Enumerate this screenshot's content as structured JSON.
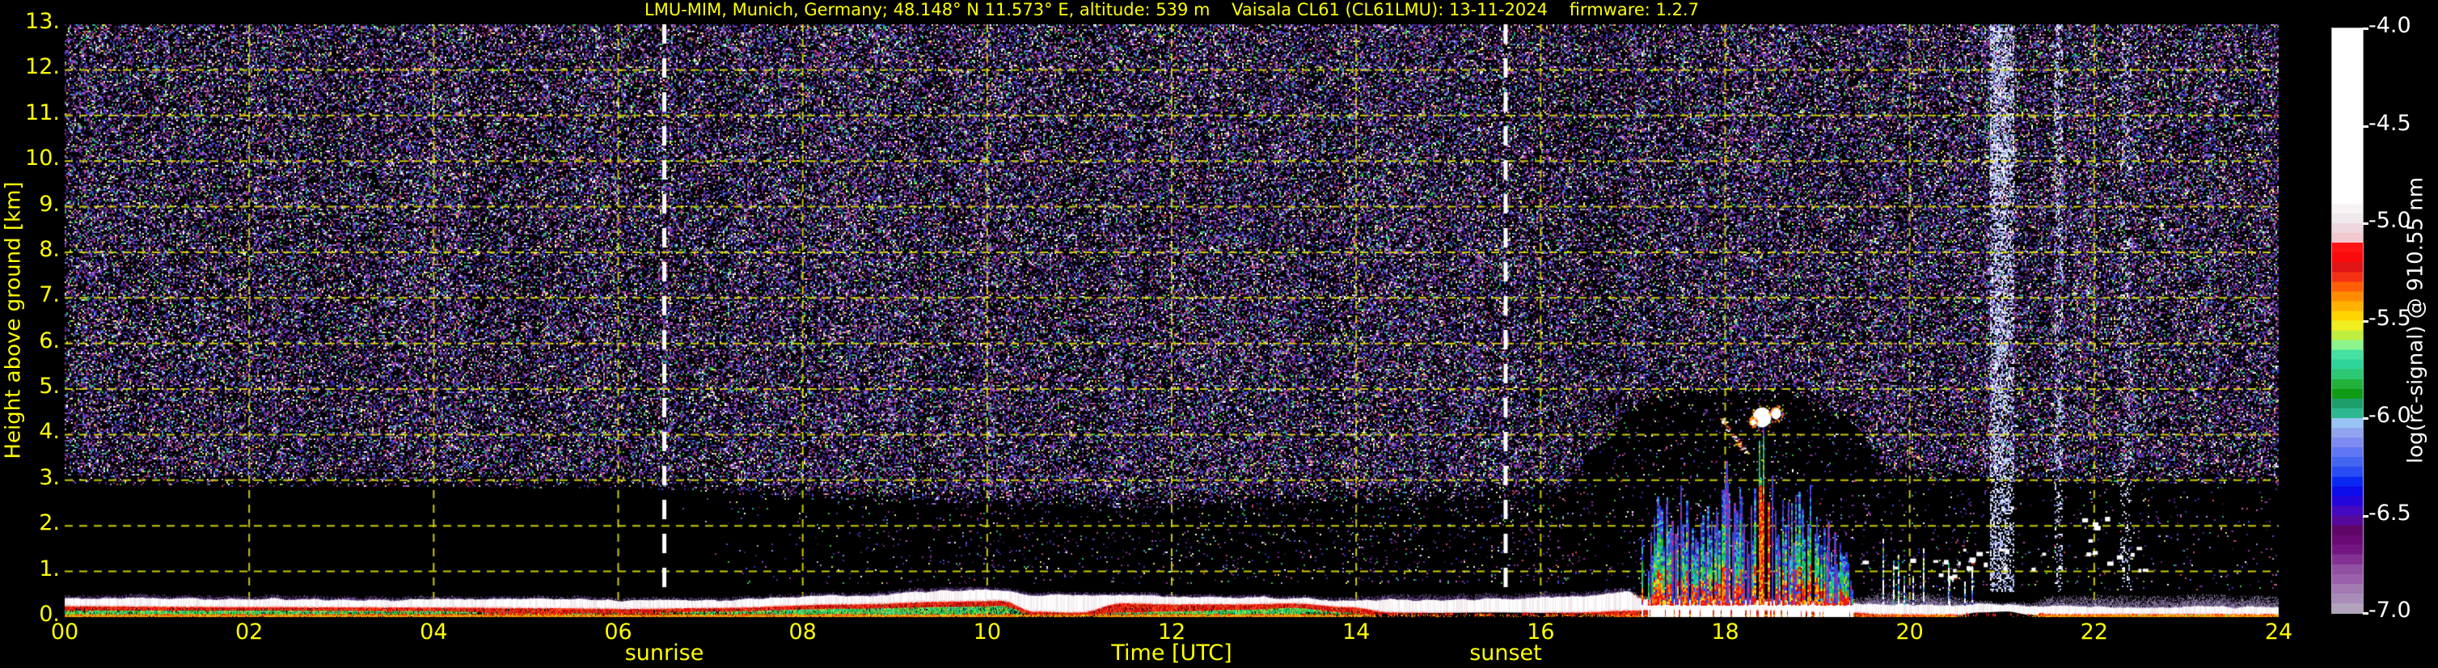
{
  "title": "LMU-MIM, Munich, Germany; 48.148° N 11.573° E, altitude: 539 m    Vaisala CL61 (CL61LMU): 13-11-2024    firmware: 1.2.7",
  "axes": {
    "x": {
      "label": "Time [UTC]",
      "ticks": [
        0,
        2,
        4,
        6,
        8,
        10,
        12,
        14,
        16,
        18,
        20,
        22,
        24
      ],
      "tick_labels": [
        "00",
        "02",
        "04",
        "06",
        "08",
        "10",
        "12",
        "14",
        "16",
        "18",
        "20",
        "22",
        "24"
      ]
    },
    "y": {
      "label": "Height above ground [km]",
      "ticks": [
        0,
        1,
        2,
        3,
        4,
        5,
        6,
        7,
        8,
        9,
        10,
        11,
        12,
        13
      ],
      "tick_labels": [
        "0.",
        "1.",
        "2.",
        "3.",
        "4.",
        "5.",
        "6.",
        "7.",
        "8.",
        "9.",
        "10.",
        "11.",
        "12.",
        "13."
      ]
    }
  },
  "annotations": {
    "sunrise": {
      "label": "sunrise",
      "time": 6.5
    },
    "sunset": {
      "label": "sunset",
      "time": 15.62
    }
  },
  "colorbar": {
    "label": "log(rc-signal) @ 910.55 nm",
    "ticks": [
      -4.0,
      -4.5,
      -5.0,
      -5.5,
      -6.0,
      -6.5,
      -7.0
    ],
    "tick_labels": [
      "-4.0",
      "-4.5",
      "-5.0",
      "-5.5",
      "-6.0",
      "-6.5",
      "-7.0"
    ],
    "blocks_bottom_to_top": [
      "#b2a4bd",
      "#a98cb7",
      "#a379b2",
      "#9b60aa",
      "#9150a2",
      "#843194",
      "#741682",
      "#6a0a74",
      "#600668",
      "#55089c",
      "#4408c0",
      "#2406da",
      "#0d0cea",
      "#0a28f4",
      "#2a4cf4",
      "#4464f2",
      "#6076f4",
      "#7e8cf2",
      "#91a4f0",
      "#98c4f4",
      "#2cb890",
      "#1d9e6a",
      "#0f9c14",
      "#22b23c",
      "#2cc874",
      "#2ed598",
      "#46e0a2",
      "#8cf58c",
      "#c0ee40",
      "#f0ee20",
      "#ffd400",
      "#ffb000",
      "#ff8c00",
      "#ff5e06",
      "#f43014",
      "#e01414",
      "#fa0a0a",
      "#ff1414",
      "#f2c8ce",
      "#eed7de",
      "#efe8ec",
      "#f7f3f5",
      "#ffffff",
      "#ffffff",
      "#ffffff",
      "#ffffff",
      "#ffffff",
      "#ffffff",
      "#ffffff",
      "#ffffff",
      "#ffffff",
      "#ffffff",
      "#ffffff",
      "#ffffff",
      "#ffffff",
      "#ffffff",
      "#ffffff",
      "#ffffff",
      "#ffffff",
      "#ffffff"
    ]
  },
  "chart_data": {
    "type": "heatmap",
    "title": "LMU-MIM, Munich, Germany; 48.148° N 11.573° E, altitude: 539 m    Vaisala CL61 (CL61LMU): 13-11-2024    firmware: 1.2.7",
    "xlabel": "Time [UTC]",
    "ylabel": "Height above ground [km]",
    "xlim": [
      0,
      24
    ],
    "ylim": [
      0,
      13
    ],
    "clim": [
      -7.0,
      -4.0
    ],
    "grid": {
      "on": true,
      "color": "#e2e200",
      "style": "dashed",
      "x_every_h": 2,
      "y_every_km": 1
    },
    "sun_lines": {
      "color": "#ffffff",
      "sunrise_t": 6.5,
      "sunset_t": 15.62
    },
    "noise": {
      "seed": 1337,
      "floor_km": [
        [
          0,
          2.9
        ],
        [
          6,
          2.85
        ],
        [
          8,
          2.6
        ],
        [
          10,
          2.45
        ],
        [
          12,
          2.4
        ],
        [
          13.5,
          2.5
        ],
        [
          15,
          2.6
        ],
        [
          16.2,
          2.7
        ],
        [
          16.6,
          3.6
        ],
        [
          17.0,
          4.6
        ],
        [
          17.6,
          4.9
        ],
        [
          18.6,
          4.9
        ],
        [
          19.3,
          4.3
        ],
        [
          19.8,
          3.1
        ],
        [
          20.5,
          2.95
        ],
        [
          24,
          2.95
        ]
      ],
      "ramp_km": 0.55,
      "base_density": 0.46,
      "palette": [
        "#2b1240",
        "#2b1240",
        "#46206e",
        "#46206e",
        "#5e2d92",
        "#5e2d92",
        "#7a3fae",
        "#3230c8",
        "#3230c8",
        "#4a55e6",
        "#8091f0",
        "#9a35a0",
        "#9a35a0",
        "#c060c0",
        "#b8a8dc",
        "#28b89c",
        "#38c848",
        "#e8e860",
        "#ffffff",
        "#d84860"
      ],
      "day_sparse": {
        "t0": 6.6,
        "t1": 16.6,
        "h0": 0.75,
        "density": 0.045
      },
      "event_sparse": {
        "t0": 16.7,
        "t1": 20.6,
        "h1": 5.2,
        "density": 0.055
      },
      "night_sparse": {
        "t0": 19.5,
        "t1": 24,
        "h0": 0.6,
        "h1": 3.0,
        "density": 0.028
      }
    },
    "pale_columns": [
      {
        "t0": 20.87,
        "t1": 21.03,
        "density": 0.5,
        "top_boost": 0.62
      },
      {
        "t0": 21.05,
        "t1": 21.13,
        "density": 0.4,
        "top_boost": 0.5
      },
      {
        "t0": 21.57,
        "t1": 21.65,
        "density": 0.28,
        "top_boost": 0.34
      },
      {
        "t0": 22.28,
        "t1": 22.4,
        "density": 0.16,
        "top_boost": 0.18
      }
    ],
    "pale_palette": [
      "#c8d0f0",
      "#a8b4ec",
      "#e4e8fa",
      "#8898e0",
      "#ffffff",
      "#b0c4f4"
    ],
    "surface": {
      "keyframes_t_g_r_w_cap_bb_oL_gS": [
        [
          0.0,
          0.14,
          0.24,
          0.42,
          0.5,
          0,
          1,
          0.9
        ],
        [
          2.0,
          0.14,
          0.22,
          0.4,
          0.48,
          0,
          1,
          1
        ],
        [
          4.0,
          0.13,
          0.21,
          0.38,
          0.45,
          0,
          1,
          0.8
        ],
        [
          4.9,
          0.08,
          0.2,
          0.41,
          0.48,
          0,
          1,
          0.35
        ],
        [
          6.2,
          0.08,
          0.18,
          0.36,
          0.43,
          0,
          1,
          0.4
        ],
        [
          7.0,
          0.12,
          0.2,
          0.38,
          0.45,
          0,
          1,
          0.8
        ],
        [
          8.5,
          0.18,
          0.28,
          0.48,
          0.55,
          0,
          1,
          1
        ],
        [
          9.6,
          0.22,
          0.34,
          0.58,
          0.66,
          0,
          1,
          1
        ],
        [
          10.15,
          0.24,
          0.36,
          0.6,
          0.66,
          0,
          1,
          0.9
        ],
        [
          10.5,
          0.06,
          0.12,
          0.5,
          0.56,
          0,
          0.8,
          0.15
        ],
        [
          11.0,
          0.05,
          0.1,
          0.48,
          0.54,
          0,
          0.8,
          0.15
        ],
        [
          11.45,
          0.1,
          0.3,
          0.5,
          0.56,
          0,
          1,
          0.7
        ],
        [
          12.0,
          0.12,
          0.28,
          0.46,
          0.52,
          0,
          1,
          1
        ],
        [
          12.8,
          0.16,
          0.28,
          0.44,
          0.5,
          0,
          1,
          1
        ],
        [
          13.3,
          0.2,
          0.3,
          0.42,
          0.48,
          0,
          1,
          1
        ],
        [
          13.9,
          0.1,
          0.22,
          0.36,
          0.44,
          0,
          0.9,
          0.5
        ],
        [
          14.4,
          0,
          0.1,
          0.38,
          0.5,
          0.08,
          0.25,
          0
        ],
        [
          15.5,
          0,
          0.08,
          0.4,
          0.52,
          0.1,
          0.2,
          0
        ],
        [
          16.4,
          0,
          0.1,
          0.46,
          0.56,
          0.08,
          0.3,
          0
        ],
        [
          16.95,
          0,
          0.14,
          0.55,
          0.62,
          0,
          0.5,
          0
        ],
        [
          17.15,
          0,
          0.15,
          0.38,
          0.46,
          0,
          0.7,
          0
        ],
        [
          18.2,
          0,
          0.15,
          0.36,
          0.44,
          0,
          0.7,
          0
        ],
        [
          19.35,
          0,
          0.1,
          0.32,
          0.42,
          0,
          0.5,
          0
        ],
        [
          19.7,
          0,
          0.06,
          0.28,
          0.55,
          0,
          0.5,
          0
        ],
        [
          20.4,
          0,
          0.05,
          0.27,
          0.5,
          0,
          0.6,
          0
        ],
        [
          20.75,
          0,
          0,
          0.3,
          0.36,
          0.1,
          0,
          0
        ],
        [
          21.05,
          0,
          0,
          0.28,
          0.34,
          0.12,
          0,
          0
        ],
        [
          21.3,
          0,
          0,
          0.26,
          0.34,
          0.05,
          0.3,
          0
        ],
        [
          21.5,
          0,
          0.05,
          0.24,
          0.45,
          0,
          1,
          0
        ],
        [
          22.3,
          0,
          0.06,
          0.22,
          0.47,
          0,
          1,
          0
        ],
        [
          23.2,
          0,
          0.06,
          0.24,
          0.5,
          0,
          1,
          0
        ],
        [
          24.0,
          0,
          0.05,
          0.22,
          0.45,
          0,
          1,
          0
        ]
      ],
      "green_fleck_window": {
        "t0": 22.3,
        "t1": 23.6,
        "prob": 0.15
      },
      "colors": {
        "orange": [
          "#ff9000",
          "#ffb400",
          "#ff6a00",
          "#ffd000"
        ],
        "green": [
          "#22c850",
          "#2cd88c",
          "#3ae0a8",
          "#a8e83c",
          "#16a832",
          "#c8e838"
        ],
        "red": [
          "#f01010",
          "#ff3c14",
          "#d80808",
          "#ff5a28"
        ],
        "white": [
          "#ffffff",
          "#ffffff",
          "#f8f4f6",
          "#efe6ea"
        ],
        "cap": [
          "#6a4890",
          "#8660b0",
          "#503070",
          "#9a80c0",
          "#3a2054"
        ],
        "cap_event": [
          "#e82010",
          "#ff6a00",
          "#8a50b0",
          "#ffffff",
          "#d8b0c0"
        ],
        "cap_late": [
          "#9a88b4",
          "#7a5fa0",
          "#b4a4cc",
          "#6a4f90",
          "#c7bcd8"
        ],
        "pink_edge": "#f2ccd2"
      }
    },
    "event": {
      "t0": 17.08,
      "t1": 19.38,
      "strip_prob": 0.78,
      "envelope": [
        [
          16.95,
          0.6
        ],
        [
          17.15,
          2.2
        ],
        [
          17.3,
          2.7
        ],
        [
          17.45,
          2.3
        ],
        [
          17.55,
          3.3
        ],
        [
          17.68,
          2.0
        ],
        [
          17.82,
          2.5
        ],
        [
          17.95,
          3.2
        ],
        [
          18.1,
          3.4
        ],
        [
          18.25,
          2.9
        ],
        [
          18.4,
          3.9
        ],
        [
          18.55,
          3.2
        ],
        [
          18.7,
          2.5
        ],
        [
          18.85,
          2.75
        ],
        [
          19.0,
          2.3
        ],
        [
          19.15,
          2.1
        ],
        [
          19.3,
          1.4
        ],
        [
          19.4,
          0.6
        ]
      ],
      "red_column": {
        "t0": 18.33,
        "t1": 18.47,
        "red_top": 2.9,
        "green_top": 4.0
      },
      "colors": {
        "low": [
          "#ee1410",
          "#ff5a00",
          "#ffd400",
          "#ff8c00",
          "#ee1410"
        ],
        "mid": [
          "#1cb444",
          "#2cd08c",
          "#a0e030",
          "#14c8b4",
          "#1cb444"
        ],
        "high": [
          "#2440e0",
          "#4468f0",
          "#1828c0",
          "#38b8e0",
          "#7040c0"
        ],
        "thin": [
          "#3040d8",
          "#5540c0",
          "#aa33aa"
        ]
      },
      "after": {
        "t0": 19.42,
        "t1": 20.72,
        "prob": 0.1,
        "max_top": 1.8
      }
    },
    "clouds": {
      "blobs": [
        {
          "t": 18.4,
          "h": 4.38,
          "rt": 0.1,
          "rh": 0.22
        },
        {
          "t": 18.55,
          "h": 4.47,
          "rt": 0.055,
          "rh": 0.13
        },
        {
          "t": 18.3,
          "h": 4.28,
          "rt": 0.03,
          "rh": 0.08
        }
      ],
      "streak": {
        "t0": 17.95,
        "h0": 4.35,
        "t1": 18.22,
        "h1": 3.62
      },
      "fringe": [
        "#ff4040",
        "#ffd400",
        "#ff8800"
      ]
    },
    "white_dots": [
      {
        "count": 26,
        "t0": 19.45,
        "t1": 22.65,
        "h0": 1.05,
        "h1": 1.55,
        "colored": false
      },
      {
        "count": 6,
        "t0": 21.85,
        "t1": 22.45,
        "h0": 1.7,
        "h1": 2.2,
        "colored": false
      },
      {
        "count": 8,
        "t0": 20.25,
        "t1": 20.7,
        "h0": 0.9,
        "h1": 1.4,
        "colored": true
      }
    ]
  }
}
